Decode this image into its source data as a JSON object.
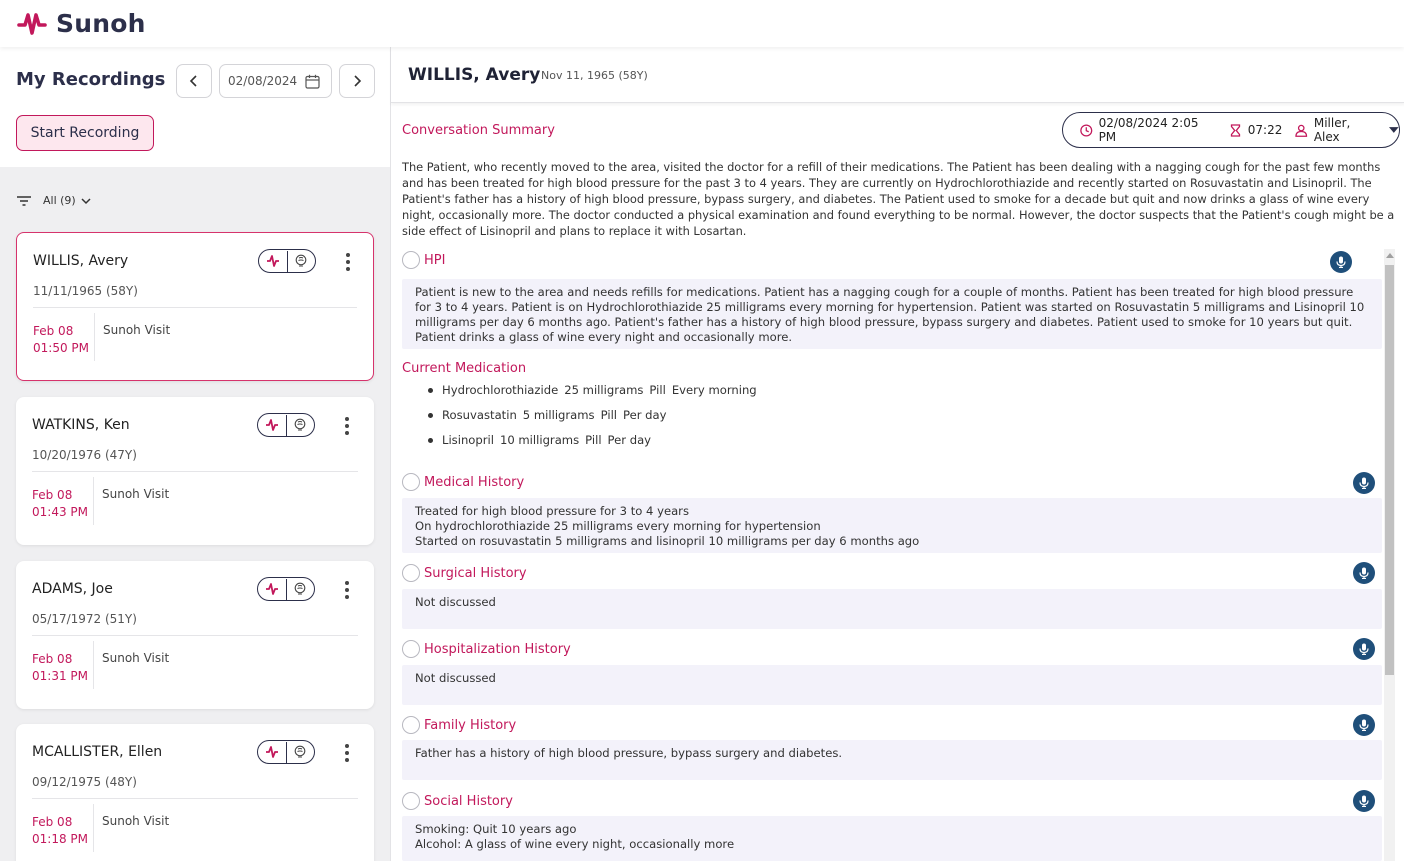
{
  "app": {
    "brand": "Sunoh",
    "accent": "#c2185b",
    "navy": "#2c2f4a"
  },
  "left": {
    "title": "My Recordings",
    "date_value": "02/08/2024",
    "start_button": "Start Recording",
    "filter_label": "All (9)",
    "cards": [
      {
        "name": "WILLIS, Avery",
        "dob": "11/11/1965 (58Y)",
        "date": "Feb 08",
        "time": "01:50 PM",
        "type": "Sunoh Visit",
        "selected": true
      },
      {
        "name": "WATKINS, Ken",
        "dob": "10/20/1976 (47Y)",
        "date": "Feb 08",
        "time": "01:43 PM",
        "type": "Sunoh Visit",
        "selected": false
      },
      {
        "name": "ADAMS, Joe",
        "dob": "05/17/1972 (51Y)",
        "date": "Feb 08",
        "time": "01:31 PM",
        "type": "Sunoh Visit",
        "selected": false
      },
      {
        "name": "MCALLISTER, Ellen",
        "dob": "09/12/1975 (48Y)",
        "date": "Feb 08",
        "time": "01:18 PM",
        "type": "Sunoh Visit",
        "selected": false
      }
    ]
  },
  "patient": {
    "name": "WILLIS, Avery",
    "dob": "Nov 11, 1965 (58Y)"
  },
  "conversation": {
    "title": "Conversation Summary",
    "datetime": "02/08/2024 2:05 PM",
    "duration": "07:22",
    "provider": "Miller, Alex",
    "summary": "The Patient, who recently moved to the area, visited the doctor for a refill of their medications. The Patient has been dealing with a nagging cough for the past few months and has been treated for high blood pressure for the past 3 to 4 years. They are currently on Hydrochlorothiazide and recently started on Rosuvastatin and Lisinopril. The Patient's father has a history of high blood pressure, bypass surgery, and diabetes. The Patient used to smoke for a decade but quit and now drinks a glass of wine every night, occasionally more. The doctor conducted a physical examination and found everything to be normal. However, the doctor suspects that the Patient's cough might be a side effect of Lisinopril and plans to replace it with Losartan."
  },
  "sections": {
    "hpi": {
      "title": "HPI",
      "text": "Patient is new to the area and needs refills for medications. Patient has a nagging cough for a couple of months. Patient has been treated for high blood pressure for 3 to 4 years. Patient is on Hydrochlorothiazide 25 milligrams every morning for hypertension. Patient was started on Rosuvastatin 5 milligrams and Lisinopril 10 milligrams per day 6 months ago. Patient's father has a history of high blood pressure, bypass surgery and diabetes. Patient used to smoke for 10 years but quit. Patient drinks a glass of wine every night and occasionally more."
    },
    "medication": {
      "title": "Current Medication",
      "items": [
        {
          "name": "Hydrochlorothiazide",
          "dose": "25 milligrams",
          "form": "Pill",
          "freq": "Every morning"
        },
        {
          "name": "Rosuvastatin",
          "dose": "5 milligrams",
          "form": "Pill",
          "freq": "Per day"
        },
        {
          "name": "Lisinopril",
          "dose": "10 milligrams",
          "form": "Pill",
          "freq": "Per day"
        }
      ]
    },
    "medical": {
      "title": "Medical History",
      "lines": [
        "Treated for high blood pressure for 3 to 4 years",
        "On hydrochlorothiazide 25 milligrams every morning for hypertension",
        "Started on rosuvastatin 5 milligrams and lisinopril 10 milligrams per day 6 months ago"
      ]
    },
    "surgical": {
      "title": "Surgical History",
      "text": "Not discussed"
    },
    "hospitalization": {
      "title": "Hospitalization History",
      "text": "Not discussed"
    },
    "family": {
      "title": "Family History",
      "text": "Father has a history of high blood pressure, bypass surgery and diabetes."
    },
    "social": {
      "title": "Social History",
      "lines": [
        "Smoking: Quit 10 years ago",
        "Alcohol: A glass of wine every night, occasionally more"
      ]
    }
  }
}
